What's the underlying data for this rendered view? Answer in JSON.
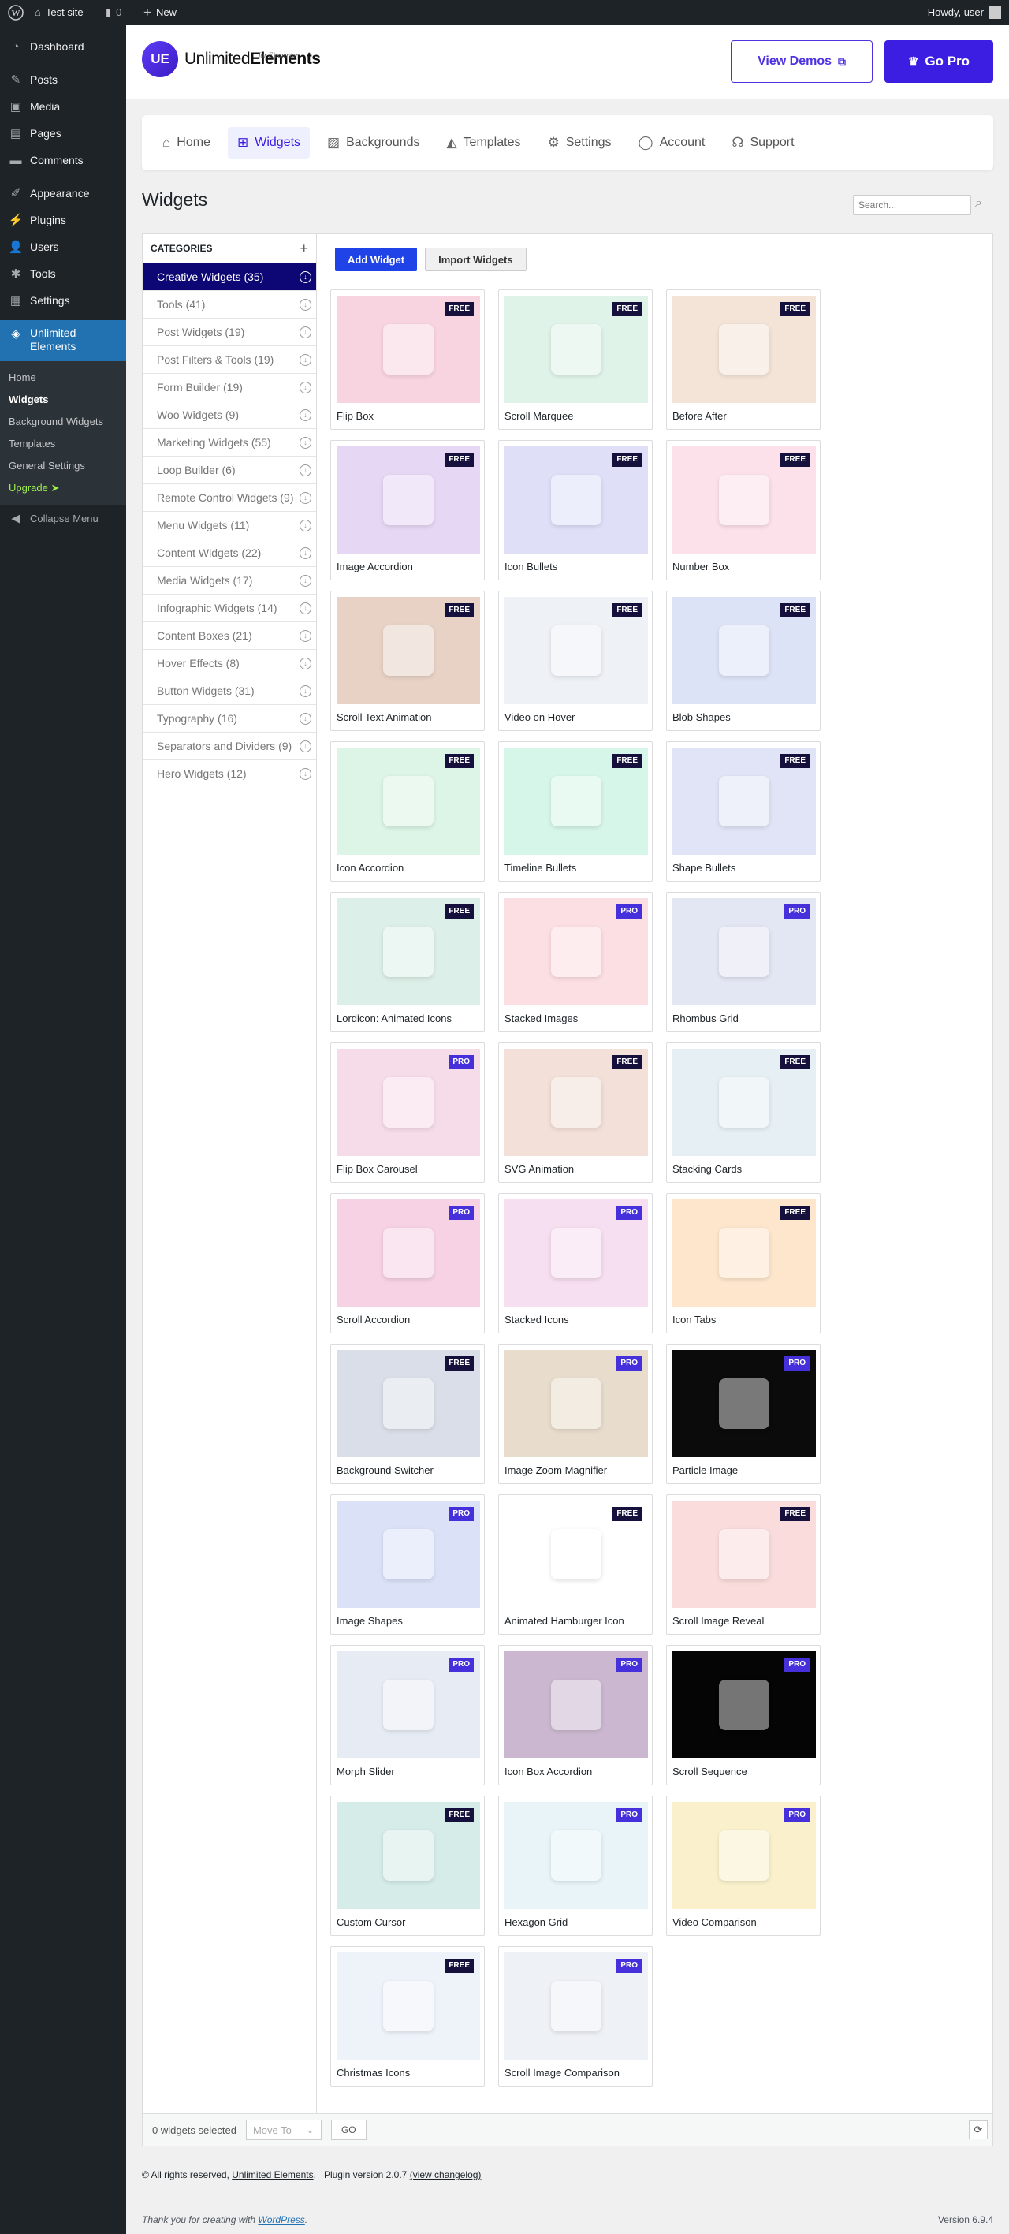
{
  "adminbar": {
    "site_name": "Test site",
    "comments_count": "0",
    "new_label": "New",
    "greeting": "Howdy, user"
  },
  "sidebar": {
    "items": [
      {
        "label": "Dashboard",
        "icon": "dashboard-icon"
      },
      {
        "label": "Posts",
        "icon": "pin-icon"
      },
      {
        "label": "Media",
        "icon": "media-icon"
      },
      {
        "label": "Pages",
        "icon": "page-icon"
      },
      {
        "label": "Comments",
        "icon": "comment-icon"
      },
      {
        "label": "Appearance",
        "icon": "brush-icon"
      },
      {
        "label": "Plugins",
        "icon": "plugin-icon"
      },
      {
        "label": "Users",
        "icon": "user-icon"
      },
      {
        "label": "Tools",
        "icon": "wrench-icon"
      },
      {
        "label": "Settings",
        "icon": "settings-icon"
      }
    ],
    "active": {
      "label": "Unlimited Elements",
      "icon": "ue-icon"
    },
    "submenu": [
      "Home",
      "Widgets",
      "Background Widgets",
      "Templates",
      "General Settings",
      "Upgrade ➤"
    ],
    "collapse": "Collapse Menu"
  },
  "header": {
    "logo_text_regular": "Unlimited",
    "logo_text_bold": "Elements",
    "logo_sub": "for Elementor",
    "logo_mark": "UE",
    "demos_label": "View Demos",
    "pro_label": "Go Pro"
  },
  "nav": {
    "tabs": [
      {
        "label": "Home",
        "icon": "home-icon",
        "glyph": "⌂"
      },
      {
        "label": "Widgets",
        "icon": "widgets-grid-icon",
        "glyph": "⊞"
      },
      {
        "label": "Backgrounds",
        "icon": "image-icon",
        "glyph": "▨"
      },
      {
        "label": "Templates",
        "icon": "templates-icon",
        "glyph": "◭"
      },
      {
        "label": "Settings",
        "icon": "gear-icon",
        "glyph": "⚙"
      },
      {
        "label": "Account",
        "icon": "account-icon",
        "glyph": "◯"
      },
      {
        "label": "Support",
        "icon": "support-icon",
        "glyph": "☊"
      }
    ]
  },
  "page": {
    "title": "Widgets",
    "search_placeholder": "Search..."
  },
  "categories": {
    "heading": "CATEGORIES",
    "items": [
      "Creative Widgets (35)",
      "Tools (41)",
      "Post Widgets (19)",
      "Post Filters & Tools (19)",
      "Form Builder (19)",
      "Woo Widgets (9)",
      "Marketing Widgets (55)",
      "Loop Builder (6)",
      "Remote Control Widgets (9)",
      "Menu Widgets (11)",
      "Content Widgets (22)",
      "Media Widgets (17)",
      "Infographic Widgets (14)",
      "Content Boxes (21)",
      "Hover Effects (8)",
      "Button Widgets (31)",
      "Typography (16)",
      "Separators and Dividers (9)",
      "Hero Widgets (12)"
    ]
  },
  "actions": {
    "add": "Add Widget",
    "import": "Import Widgets"
  },
  "widgets": [
    {
      "title": "Flip Box",
      "badge": "FREE",
      "color": "#f8d3e0"
    },
    {
      "title": "Scroll Marquee",
      "badge": "FREE",
      "color": "#dff3e8"
    },
    {
      "title": "Before After",
      "badge": "FREE",
      "color": "#f4e4d8"
    },
    {
      "title": "Image Accordion",
      "badge": "FREE",
      "color": "#e6d8f4"
    },
    {
      "title": "Icon Bullets",
      "badge": "FREE",
      "color": "#dfe0f8"
    },
    {
      "title": "Number Box",
      "badge": "FREE",
      "color": "#fce0ea"
    },
    {
      "title": "Scroll Text Animation",
      "badge": "FREE",
      "color": "#e8d2c6"
    },
    {
      "title": "Video on Hover",
      "badge": "FREE",
      "color": "#eef1f6"
    },
    {
      "title": "Blob Shapes",
      "badge": "FREE",
      "color": "#dde3f6"
    },
    {
      "title": "Icon Accordion",
      "badge": "FREE",
      "color": "#dcf5e6"
    },
    {
      "title": "Timeline Bullets",
      "badge": "FREE",
      "color": "#d7f6ea"
    },
    {
      "title": "Shape Bullets",
      "badge": "FREE",
      "color": "#e0e4f6"
    },
    {
      "title": "Lordicon: Animated Icons",
      "badge": "FREE",
      "color": "#dcefe8"
    },
    {
      "title": "Stacked Images",
      "badge": "PRO",
      "color": "#fcdfe2"
    },
    {
      "title": "Rhombus Grid",
      "badge": "PRO",
      "color": "#e3e6f3"
    },
    {
      "title": "Flip Box Carousel",
      "badge": "PRO",
      "color": "#f6dce8"
    },
    {
      "title": "SVG Animation",
      "badge": "FREE",
      "color": "#f3e0d8"
    },
    {
      "title": "Stacking Cards",
      "badge": "FREE",
      "color": "#e6f0f4"
    },
    {
      "title": "Scroll Accordion",
      "badge": "PRO",
      "color": "#f6d2e4"
    },
    {
      "title": "Stacked Icons",
      "badge": "PRO",
      "color": "#f6dff0"
    },
    {
      "title": "Icon Tabs",
      "badge": "FREE",
      "color": "#fde6cc"
    },
    {
      "title": "Background Switcher",
      "badge": "FREE",
      "color": "#d9dee8"
    },
    {
      "title": "Image Zoom Magnifier",
      "badge": "PRO",
      "color": "#e8dccd"
    },
    {
      "title": "Particle Image",
      "badge": "PRO",
      "color": "#0b0b0b"
    },
    {
      "title": "Image Shapes",
      "badge": "PRO",
      "color": "#dbe2f8"
    },
    {
      "title": "Animated Hamburger Icon",
      "badge": "FREE",
      "color": "#ffffff"
    },
    {
      "title": "Scroll Image Reveal",
      "badge": "FREE",
      "color": "#fadcdc"
    },
    {
      "title": "Morph Slider",
      "badge": "PRO",
      "color": "#e7ecf4"
    },
    {
      "title": "Icon Box Accordion",
      "badge": "PRO",
      "color": "#cbb8d0"
    },
    {
      "title": "Scroll Sequence",
      "badge": "PRO",
      "color": "#050505"
    },
    {
      "title": "Custom Cursor",
      "badge": "FREE",
      "color": "#d5ece8"
    },
    {
      "title": "Hexagon Grid",
      "badge": "PRO",
      "color": "#e8f4f8"
    },
    {
      "title": "Video Comparison",
      "badge": "PRO",
      "color": "#faf1cc"
    },
    {
      "title": "Christmas Icons",
      "badge": "FREE",
      "color": "#eef3fa"
    },
    {
      "title": "Scroll Image Comparison",
      "badge": "PRO",
      "color": "#eef1f6"
    }
  ],
  "footer_bar": {
    "selected": "0 widgets selected",
    "move_to": "Move To",
    "go": "GO"
  },
  "footer": {
    "copyright_prefix": "© All rights reserved,",
    "copyright_link": "Unlimited Elements",
    "plugin_version": "Plugin version 2.0.7",
    "changelog": "(view changelog)",
    "thanks_prefix": "Thank you for creating with",
    "thanks_link": "WordPress",
    "wp_version": "Version 6.9.4"
  },
  "colors": {
    "accent": "#3c1ee2",
    "wp_blue": "#2271b1",
    "free_badge": "#16113c",
    "pro_badge": "#4530dc"
  }
}
